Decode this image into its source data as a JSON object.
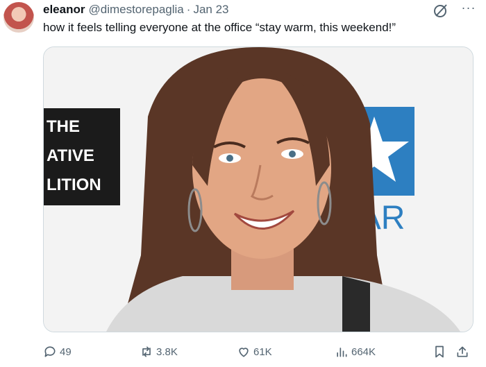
{
  "tweet": {
    "display_name": "eleanor",
    "handle": "@dimestorepaglia",
    "separator": "·",
    "date": "Jan 23",
    "text": "how it feels telling everyone at the office “stay warm, this weekend!”",
    "more": "···"
  },
  "media": {
    "left_sign_lines": [
      "THE",
      "ATIVE",
      "LITION"
    ],
    "right_sign_text": "TAR"
  },
  "actions": {
    "replies": "49",
    "reposts": "3.8K",
    "likes": "61K",
    "views": "664K"
  },
  "icons": {
    "reply": "reply-icon",
    "repost": "repost-icon",
    "like": "heart-icon",
    "views": "views-icon",
    "bookmark": "bookmark-icon",
    "share": "share-icon",
    "grok": "grok-icon",
    "more": "more-icon"
  },
  "colors": {
    "text": "#0f1419",
    "muted": "#536471",
    "sign_blue": "#2d7fc1"
  }
}
